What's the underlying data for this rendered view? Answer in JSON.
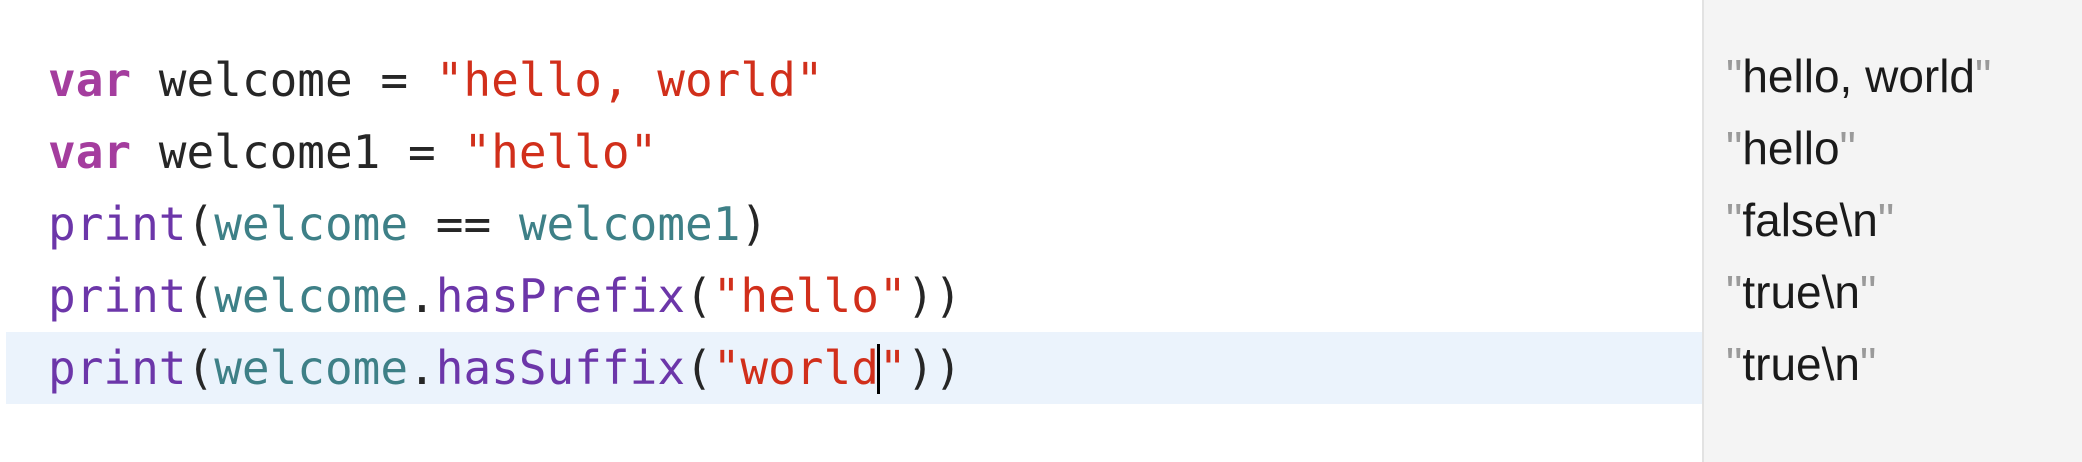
{
  "editor": {
    "lines": [
      {
        "kw": "var",
        "rest": " welcome = ",
        "str": "\"hello, world\""
      },
      {
        "kw": "var",
        "rest": " welcome1 = ",
        "str": "\"hello\""
      },
      {
        "fn": "print",
        "open": "(",
        "var_a": "welcome",
        "op": " == ",
        "var_b": "welcome1",
        "close": ")"
      },
      {
        "fn": "print",
        "open": "(",
        "var": "welcome",
        "dot": ".",
        "method": "hasPrefix",
        "open2": "(",
        "str": "\"hello\"",
        "close": "))"
      },
      {
        "fn": "print",
        "open": "(",
        "var": "welcome",
        "dot": ".",
        "method": "hasSuffix",
        "open2": "(",
        "str_before_caret": "\"world",
        "str_after_caret": "\"",
        "close": "))"
      }
    ]
  },
  "results": [
    {
      "quote": "\"",
      "text": "hello, world",
      "quote_end": "\""
    },
    {
      "quote": "\"",
      "text": "hello",
      "quote_end": "\""
    },
    {
      "quote": "\"",
      "text": "false\\n",
      "quote_end": "\""
    },
    {
      "quote": "\"",
      "text": "true\\n",
      "quote_end": "\""
    },
    {
      "quote": "\"",
      "text": "true\\n",
      "quote_end": "\""
    }
  ],
  "colors": {
    "keyword": "#a43d9e",
    "string": "#d12f1b",
    "variable": "#3e8087",
    "function": "#6c36a9",
    "current_line_highlight": "#ebf3fc",
    "results_background": "#f4f4f4"
  }
}
